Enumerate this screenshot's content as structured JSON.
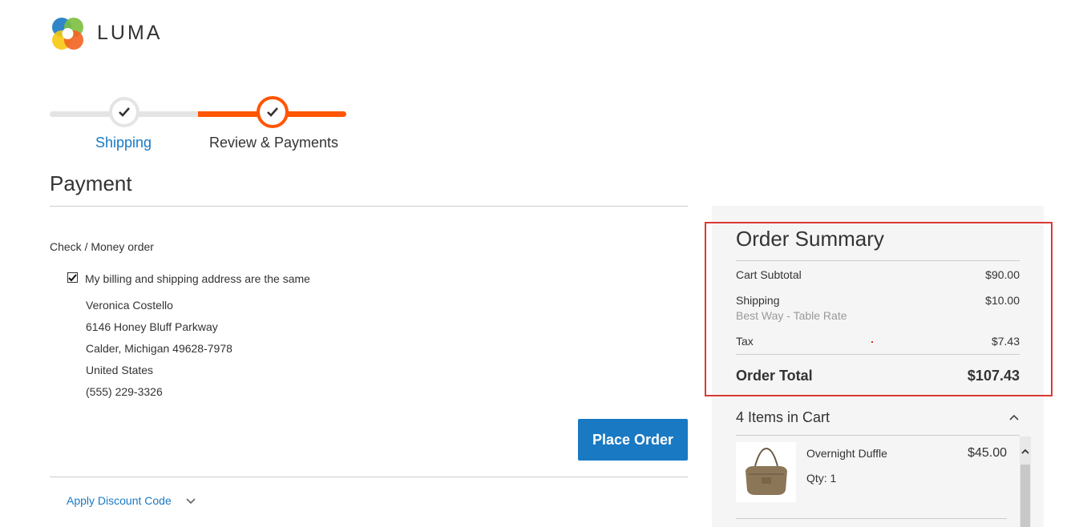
{
  "brand": {
    "name": "LUMA"
  },
  "progress": {
    "steps": [
      {
        "label": "Shipping",
        "state": "complete"
      },
      {
        "label": "Review & Payments",
        "state": "active"
      }
    ],
    "colors": {
      "active": "#ff5501",
      "inactive": "#e4e4e4",
      "link": "#1979c3"
    }
  },
  "payment": {
    "title": "Payment",
    "method_label": "Check / Money order",
    "same_address_label": "My billing and shipping address are the same",
    "same_address_checked": true,
    "address": {
      "name": "Veronica Costello",
      "street": "6146 Honey Bluff Parkway",
      "city_line": "Calder, Michigan 49628-7978",
      "country": "United States",
      "phone": "(555) 229-3326"
    },
    "place_order_label": "Place Order",
    "discount_label": "Apply Discount Code"
  },
  "summary": {
    "title": "Order Summary",
    "cart_subtotal_label": "Cart Subtotal",
    "cart_subtotal_value": "$90.00",
    "shipping_label": "Shipping",
    "shipping_method": "Best Way - Table Rate",
    "shipping_value": "$10.00",
    "tax_label": "Tax",
    "tax_value": "$7.43",
    "total_label": "Order Total",
    "total_value": "$107.43"
  },
  "cart": {
    "items_title": "4 Items in Cart",
    "items": [
      {
        "name": "Overnight Duffle",
        "qty": "Qty: 1",
        "price": "$45.00"
      }
    ]
  }
}
